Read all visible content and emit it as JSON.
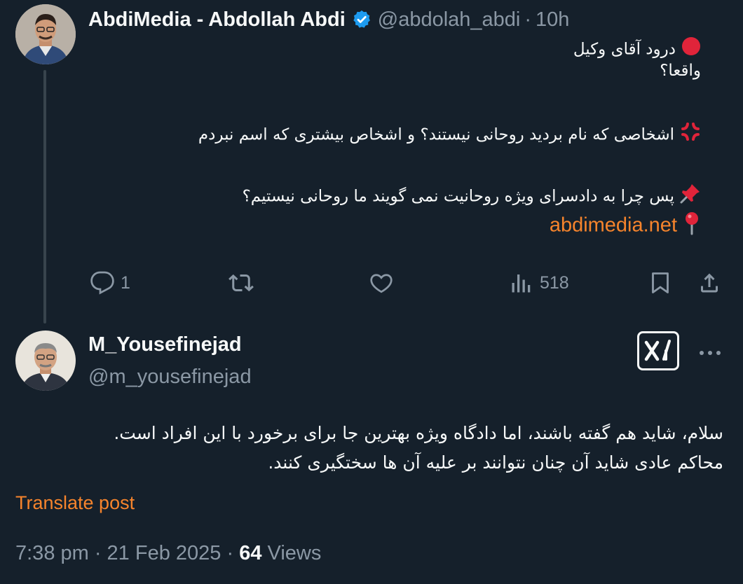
{
  "tweet1": {
    "author_name": "AbdiMedia - Abdollah Abdi",
    "handle": "@abdolah_abdi",
    "separator": "·",
    "time": "10h",
    "lines": [
      "درود آقای وکیل",
      "واقعا؟",
      "",
      "اشخاصی که نام بردید روحانی نیستند؟ و اشخاص بیشتری که اسم نبردم",
      "",
      "پس چرا به دادسرای ویژه روحانیت نمی گویند ما روحانی نیستیم؟"
    ],
    "link_text": "abdimedia.net",
    "emojis": [
      "red-circle",
      "anger-symbol",
      "pushpin",
      "round-pushpin"
    ],
    "actions": {
      "reply_count": "1",
      "retweet_count": "",
      "like_count": "",
      "views_count": "518"
    }
  },
  "tweet2": {
    "author_name": "M_Yousefinejad",
    "handle": "@m_yousefinejad",
    "text_line1": "سلام، شاید هم گفته باشند، اما دادگاه ویژه بهترین جا برای برخورد با این افراد است.",
    "text_line2": "محاکم عادی شاید آن چنان نتوانند بر علیه آن ها سختگیری کنند.",
    "translate_label": "Translate post",
    "timestamp": "7:38 pm · 21 Feb 2025 · ",
    "views_count": "64",
    "views_label": "Views"
  },
  "colors": {
    "background": "#15202b",
    "text": "#f7f9f9",
    "muted": "#8b98a5",
    "accent": "#f6842c",
    "verified": "#1d9bf0"
  }
}
